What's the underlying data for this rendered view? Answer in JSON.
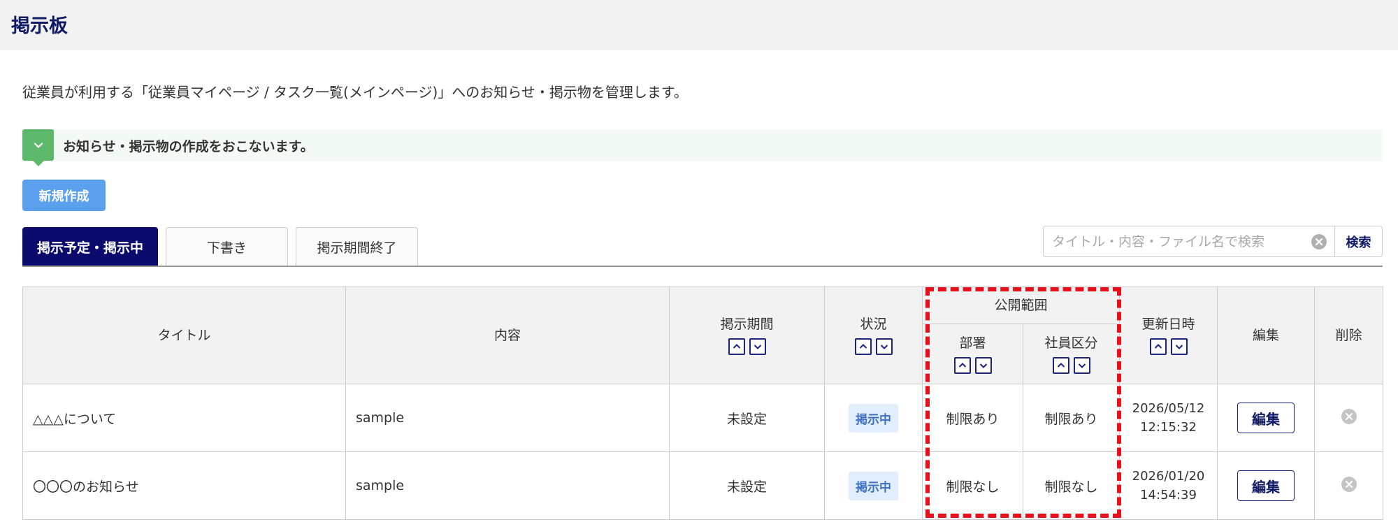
{
  "page": {
    "title": "掲示板"
  },
  "description": "従業員が利用する「従業員マイページ / タスク一覧(メインページ)」へのお知らせ・掲示物を管理します。",
  "notice": {
    "label": "お知らせ・掲示物の作成をおこないます。",
    "icon": "chevron-down-icon"
  },
  "toolbar": {
    "new_label": "新規作成"
  },
  "tabs": [
    {
      "label": "掲示予定・掲示中",
      "active": true
    },
    {
      "label": "下書き",
      "active": false
    },
    {
      "label": "掲示期間終了",
      "active": false
    }
  ],
  "search": {
    "placeholder": "タイトル・内容・ファイル名で検索",
    "value": "",
    "button_label": "検索"
  },
  "table": {
    "headers": {
      "title": "タイトル",
      "content": "内容",
      "period": "掲示期間",
      "status": "状況",
      "scope": "公開範囲",
      "department": "部署",
      "employee_type": "社員区分",
      "updated": "更新日時",
      "edit": "編集",
      "delete": "削除"
    },
    "rows": [
      {
        "title": "△△△について",
        "content": "sample",
        "period": "未設定",
        "status": "掲示中",
        "department": "制限あり",
        "employee_type": "制限あり",
        "updated_date": "2026/05/12",
        "updated_time": "12:15:32",
        "edit_label": "編集"
      },
      {
        "title": "〇〇〇のお知らせ",
        "content": "sample",
        "period": "未設定",
        "status": "掲示中",
        "department": "制限なし",
        "employee_type": "制限なし",
        "updated_date": "2026/01/20",
        "updated_time": "14:54:39",
        "edit_label": "編集"
      }
    ]
  },
  "colors": {
    "header_navy": "#111a66",
    "active_tab": "#0b0b6e",
    "new_button": "#5ba0ec",
    "notice_green": "#5cb86a",
    "status_badge_bg": "#e3eefc",
    "highlight_red": "#e8101a"
  }
}
